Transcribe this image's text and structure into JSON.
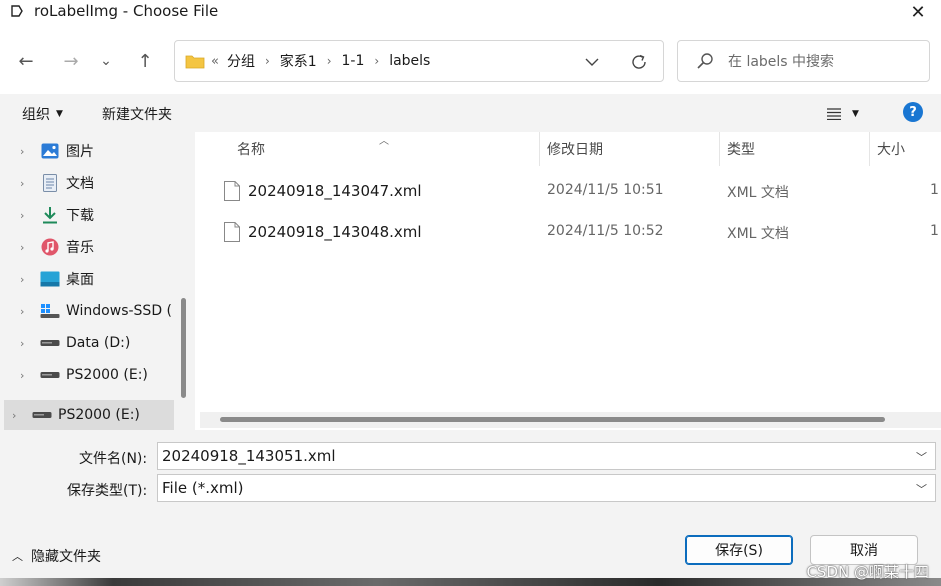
{
  "window": {
    "title": "roLabelImg - Choose File",
    "close_glyph": "✕"
  },
  "nav": {
    "back_glyph": "←",
    "forward_glyph": "→",
    "recent_glyph": "⌄",
    "up_glyph": "↑",
    "address_prefix": "«",
    "breadcrumbs": [
      "分组",
      "家系1",
      "1-1",
      "labels"
    ],
    "crumb_sep": "›",
    "search_placeholder": "在 labels 中搜索"
  },
  "toolbar": {
    "organize_label": "组织",
    "new_folder_label": "新建文件夹",
    "help_label": "?"
  },
  "sidebar": {
    "items": [
      {
        "label": "图片",
        "icon": "pictures-icon"
      },
      {
        "label": "文档",
        "icon": "documents-icon"
      },
      {
        "label": "下载",
        "icon": "downloads-icon"
      },
      {
        "label": "音乐",
        "icon": "music-icon"
      },
      {
        "label": "桌面",
        "icon": "desktop-icon"
      },
      {
        "label": "Windows-SSD (",
        "icon": "windows-drive-icon"
      },
      {
        "label": "Data (D:)",
        "icon": "drive-icon"
      },
      {
        "label": "PS2000 (E:)",
        "icon": "drive-icon"
      }
    ],
    "selected": {
      "label": "PS2000 (E:)",
      "icon": "drive-icon"
    }
  },
  "columns": {
    "name": "名称",
    "date": "修改日期",
    "type": "类型",
    "size": "大小"
  },
  "files": [
    {
      "name": "20240918_143047.xml",
      "date": "2024/11/5 10:51",
      "type": "XML 文档",
      "size": "1"
    },
    {
      "name": "20240918_143048.xml",
      "date": "2024/11/5 10:52",
      "type": "XML 文档",
      "size": "1"
    }
  ],
  "form": {
    "filename_label": "文件名(N):",
    "filename_value": "20240918_143051.xml",
    "filetype_label": "保存类型(T):",
    "filetype_value": "File (*.xml)",
    "save_label": "保存(S)",
    "cancel_label": "取消",
    "hide_folders_label": "隐藏文件夹"
  },
  "watermark": "CSDN @啊某十四",
  "colors": {
    "accent": "#1976d2",
    "pane_bg": "#f3f3f3",
    "folder_yellow": "#f4c542"
  }
}
